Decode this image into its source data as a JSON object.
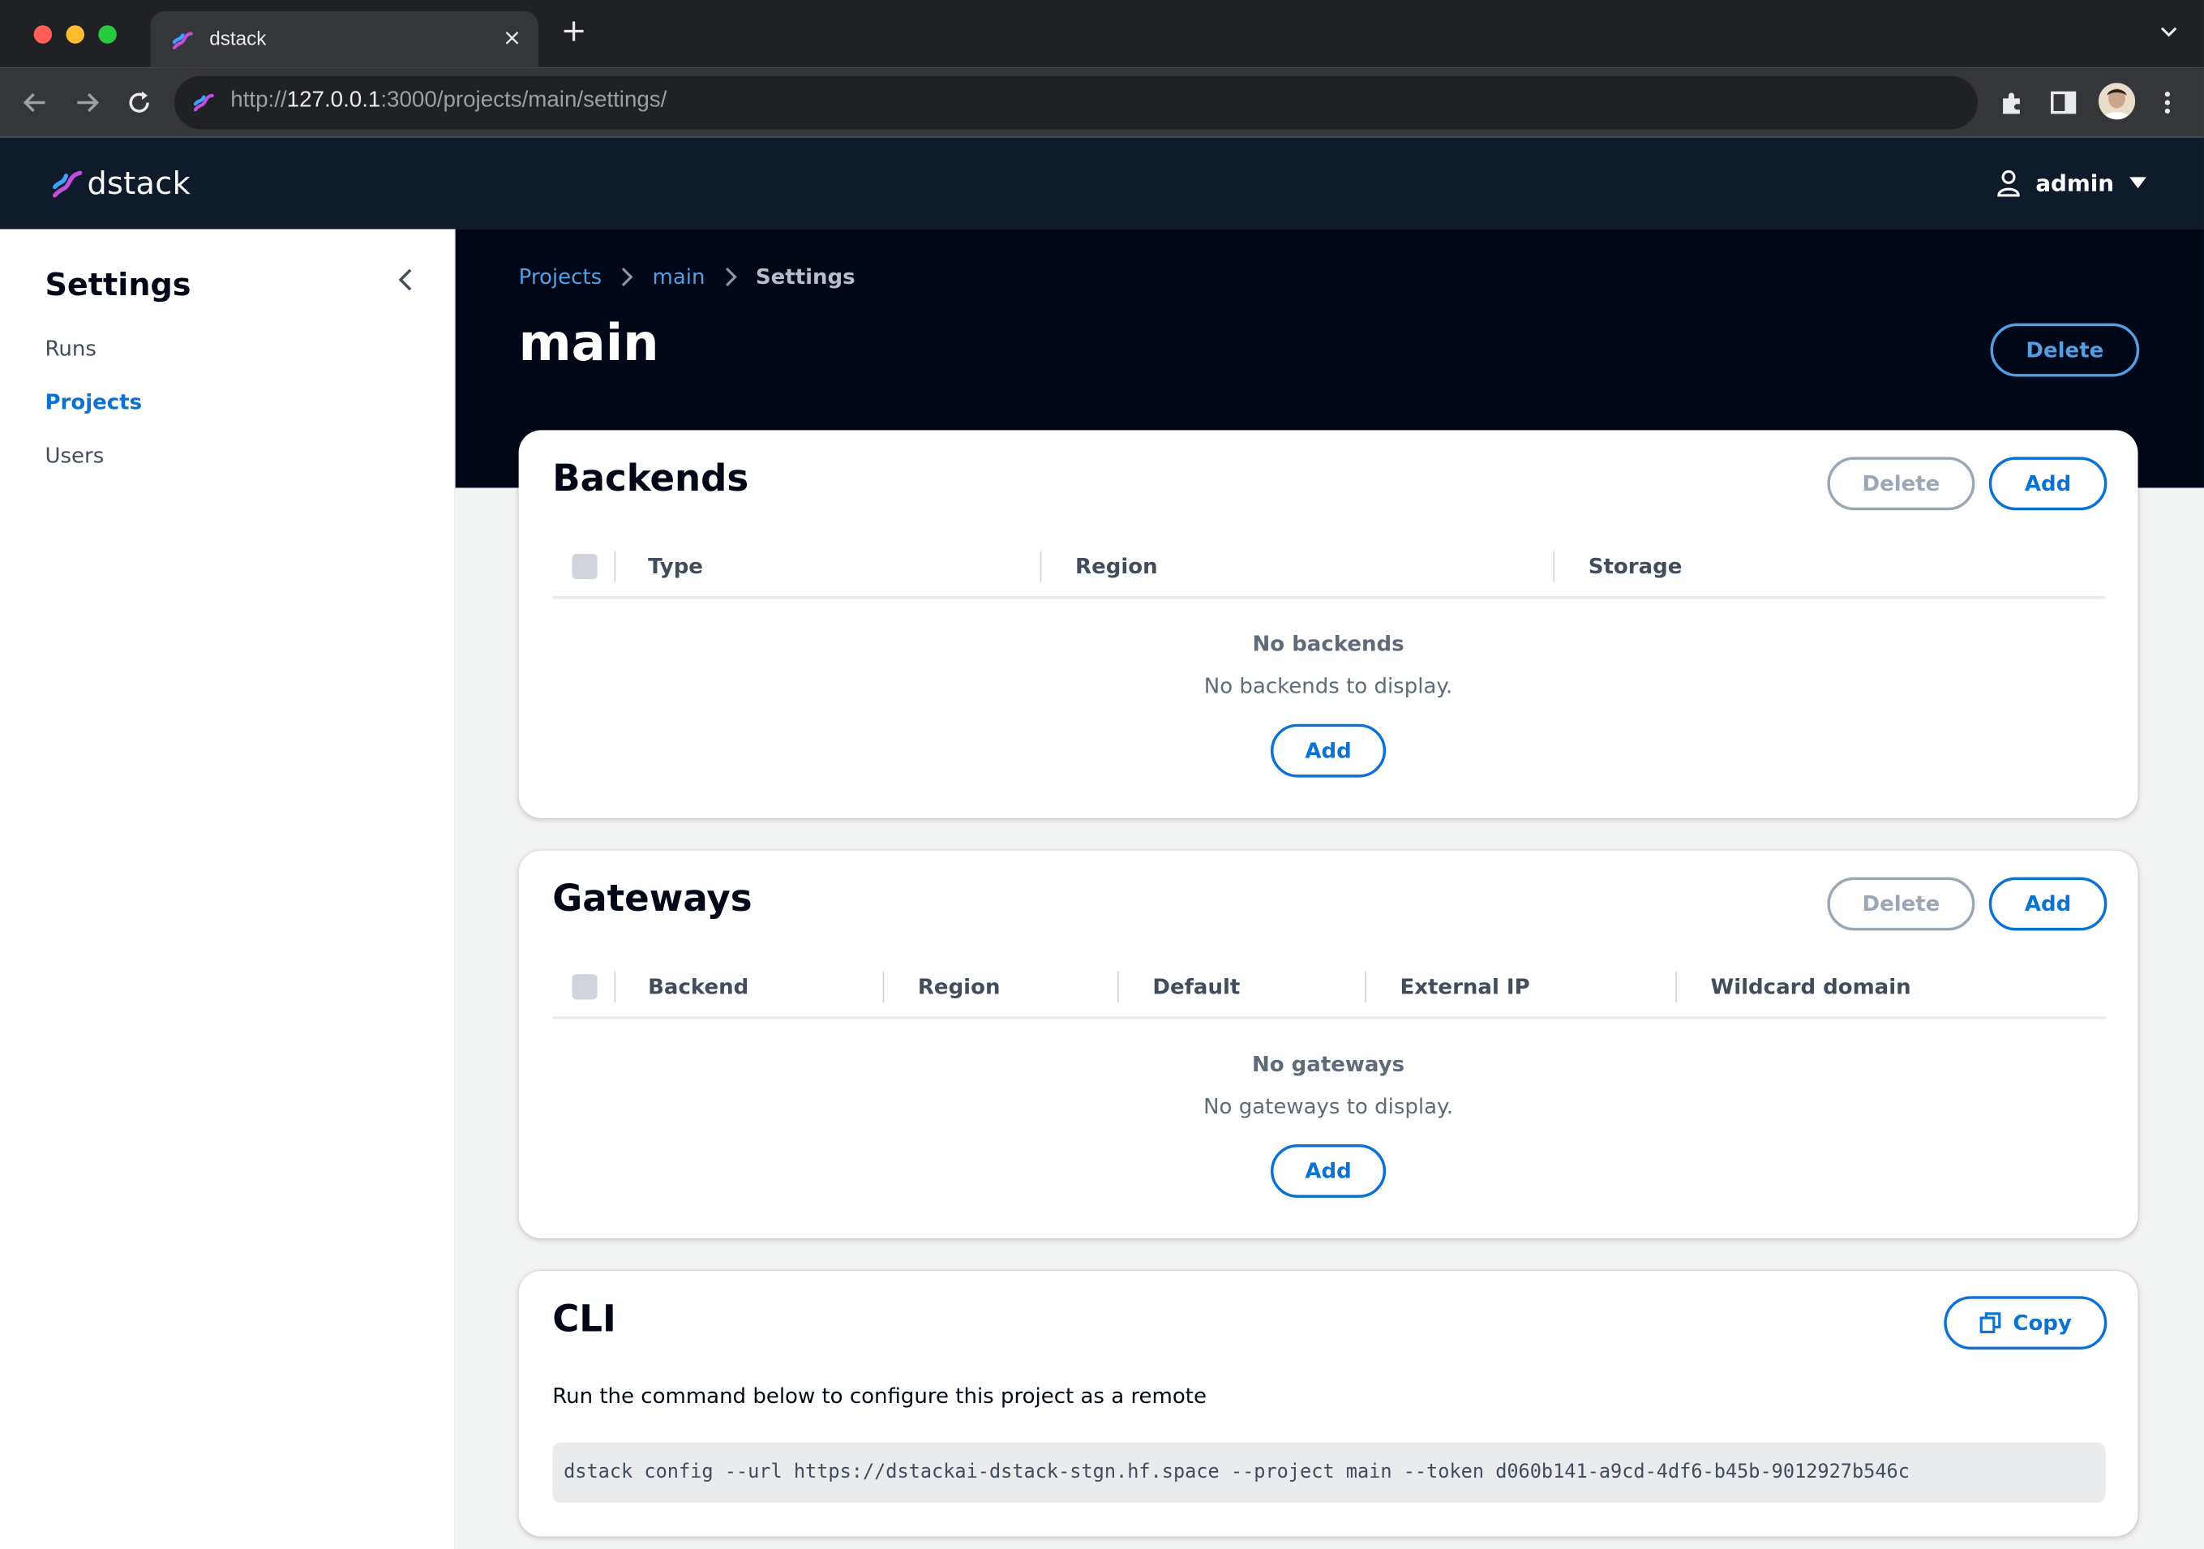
{
  "browser": {
    "tab_title": "dstack",
    "tab_close": "×",
    "new_tab": "+",
    "url_prefix": "http://",
    "url_host": "127.0.0.1",
    "url_rest": ":3000/projects/main/settings/"
  },
  "app": {
    "logo_text": "dstack",
    "user_name": "admin"
  },
  "sidebar": {
    "title": "Settings",
    "items": [
      {
        "label": "Runs",
        "active": false
      },
      {
        "label": "Projects",
        "active": true
      },
      {
        "label": "Users",
        "active": false
      }
    ]
  },
  "breadcrumb": {
    "items": [
      "Projects",
      "main",
      "Settings"
    ]
  },
  "page": {
    "title": "main",
    "delete_label": "Delete"
  },
  "backends": {
    "title": "Backends",
    "delete_label": "Delete",
    "add_label": "Add",
    "columns": [
      "Type",
      "Region",
      "Storage"
    ],
    "empty_title": "No backends",
    "empty_sub": "No backends to display.",
    "empty_add": "Add"
  },
  "gateways": {
    "title": "Gateways",
    "delete_label": "Delete",
    "add_label": "Add",
    "columns": [
      "Backend",
      "Region",
      "Default",
      "External IP",
      "Wildcard domain"
    ],
    "empty_title": "No gateways",
    "empty_sub": "No gateways to display.",
    "empty_add": "Add"
  },
  "cli": {
    "title": "CLI",
    "copy_label": "Copy",
    "description": "Run the command below to configure this project as a remote",
    "command": "dstack config --url https://dstackai-dstack-stgn.hf.space --project main --token d060b141-a9cd-4df6-b45b-9012927b546c"
  },
  "colors": {
    "accent": "#0972d3",
    "hero_bg": "#000716",
    "appbar_bg": "#0f1b2a"
  }
}
